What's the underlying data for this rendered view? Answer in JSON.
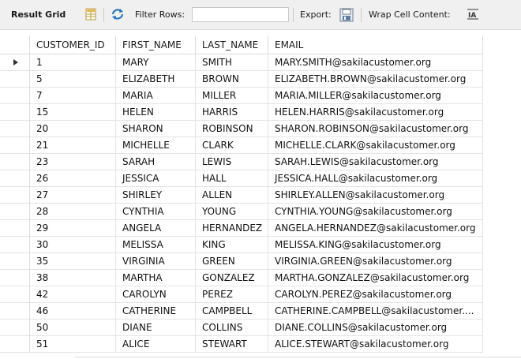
{
  "toolbar": {
    "result_grid_label": "Result Grid",
    "filter_rows_label": "Filter Rows:",
    "filter_rows_value": "",
    "export_label": "Export:",
    "wrap_cell_label": "Wrap Cell Content:",
    "icons": [
      "grid-view-icon",
      "refresh-icon",
      "export-icon",
      "wrap-text-icon"
    ],
    "accent_color": "#1e73be"
  },
  "columns": [
    "CUSTOMER_ID",
    "FIRST_NAME",
    "LAST_NAME",
    "EMAIL"
  ],
  "rows": [
    {
      "id": "1",
      "first": "MARY",
      "last": "SMITH",
      "email": "MARY.SMITH@sakilacustomer.org"
    },
    {
      "id": "5",
      "first": "ELIZABETH",
      "last": "BROWN",
      "email": "ELIZABETH.BROWN@sakilacustomer.org"
    },
    {
      "id": "7",
      "first": "MARIA",
      "last": "MILLER",
      "email": "MARIA.MILLER@sakilacustomer.org"
    },
    {
      "id": "15",
      "first": "HELEN",
      "last": "HARRIS",
      "email": "HELEN.HARRIS@sakilacustomer.org"
    },
    {
      "id": "20",
      "first": "SHARON",
      "last": "ROBINSON",
      "email": "SHARON.ROBINSON@sakilacustomer.org"
    },
    {
      "id": "21",
      "first": "MICHELLE",
      "last": "CLARK",
      "email": "MICHELLE.CLARK@sakilacustomer.org"
    },
    {
      "id": "23",
      "first": "SARAH",
      "last": "LEWIS",
      "email": "SARAH.LEWIS@sakilacustomer.org"
    },
    {
      "id": "26",
      "first": "JESSICA",
      "last": "HALL",
      "email": "JESSICA.HALL@sakilacustomer.org"
    },
    {
      "id": "27",
      "first": "SHIRLEY",
      "last": "ALLEN",
      "email": "SHIRLEY.ALLEN@sakilacustomer.org"
    },
    {
      "id": "28",
      "first": "CYNTHIA",
      "last": "YOUNG",
      "email": "CYNTHIA.YOUNG@sakilacustomer.org"
    },
    {
      "id": "29",
      "first": "ANGELA",
      "last": "HERNANDEZ",
      "email": "ANGELA.HERNANDEZ@sakilacustomer.org"
    },
    {
      "id": "30",
      "first": "MELISSA",
      "last": "KING",
      "email": "MELISSA.KING@sakilacustomer.org"
    },
    {
      "id": "35",
      "first": "VIRGINIA",
      "last": "GREEN",
      "email": "VIRGINIA.GREEN@sakilacustomer.org"
    },
    {
      "id": "38",
      "first": "MARTHA",
      "last": "GONZALEZ",
      "email": "MARTHA.GONZALEZ@sakilacustomer.org"
    },
    {
      "id": "42",
      "first": "CAROLYN",
      "last": "PEREZ",
      "email": "CAROLYN.PEREZ@sakilacustomer.org"
    },
    {
      "id": "46",
      "first": "CATHERINE",
      "last": "CAMPBELL",
      "email": "CATHERINE.CAMPBELL@sakilacustomer...."
    },
    {
      "id": "50",
      "first": "DIANE",
      "last": "COLLINS",
      "email": "DIANE.COLLINS@sakilacustomer.org"
    },
    {
      "id": "51",
      "first": "ALICE",
      "last": "STEWART",
      "email": "ALICE.STEWART@sakilacustomer.org"
    }
  ],
  "selected_row_index": 0
}
